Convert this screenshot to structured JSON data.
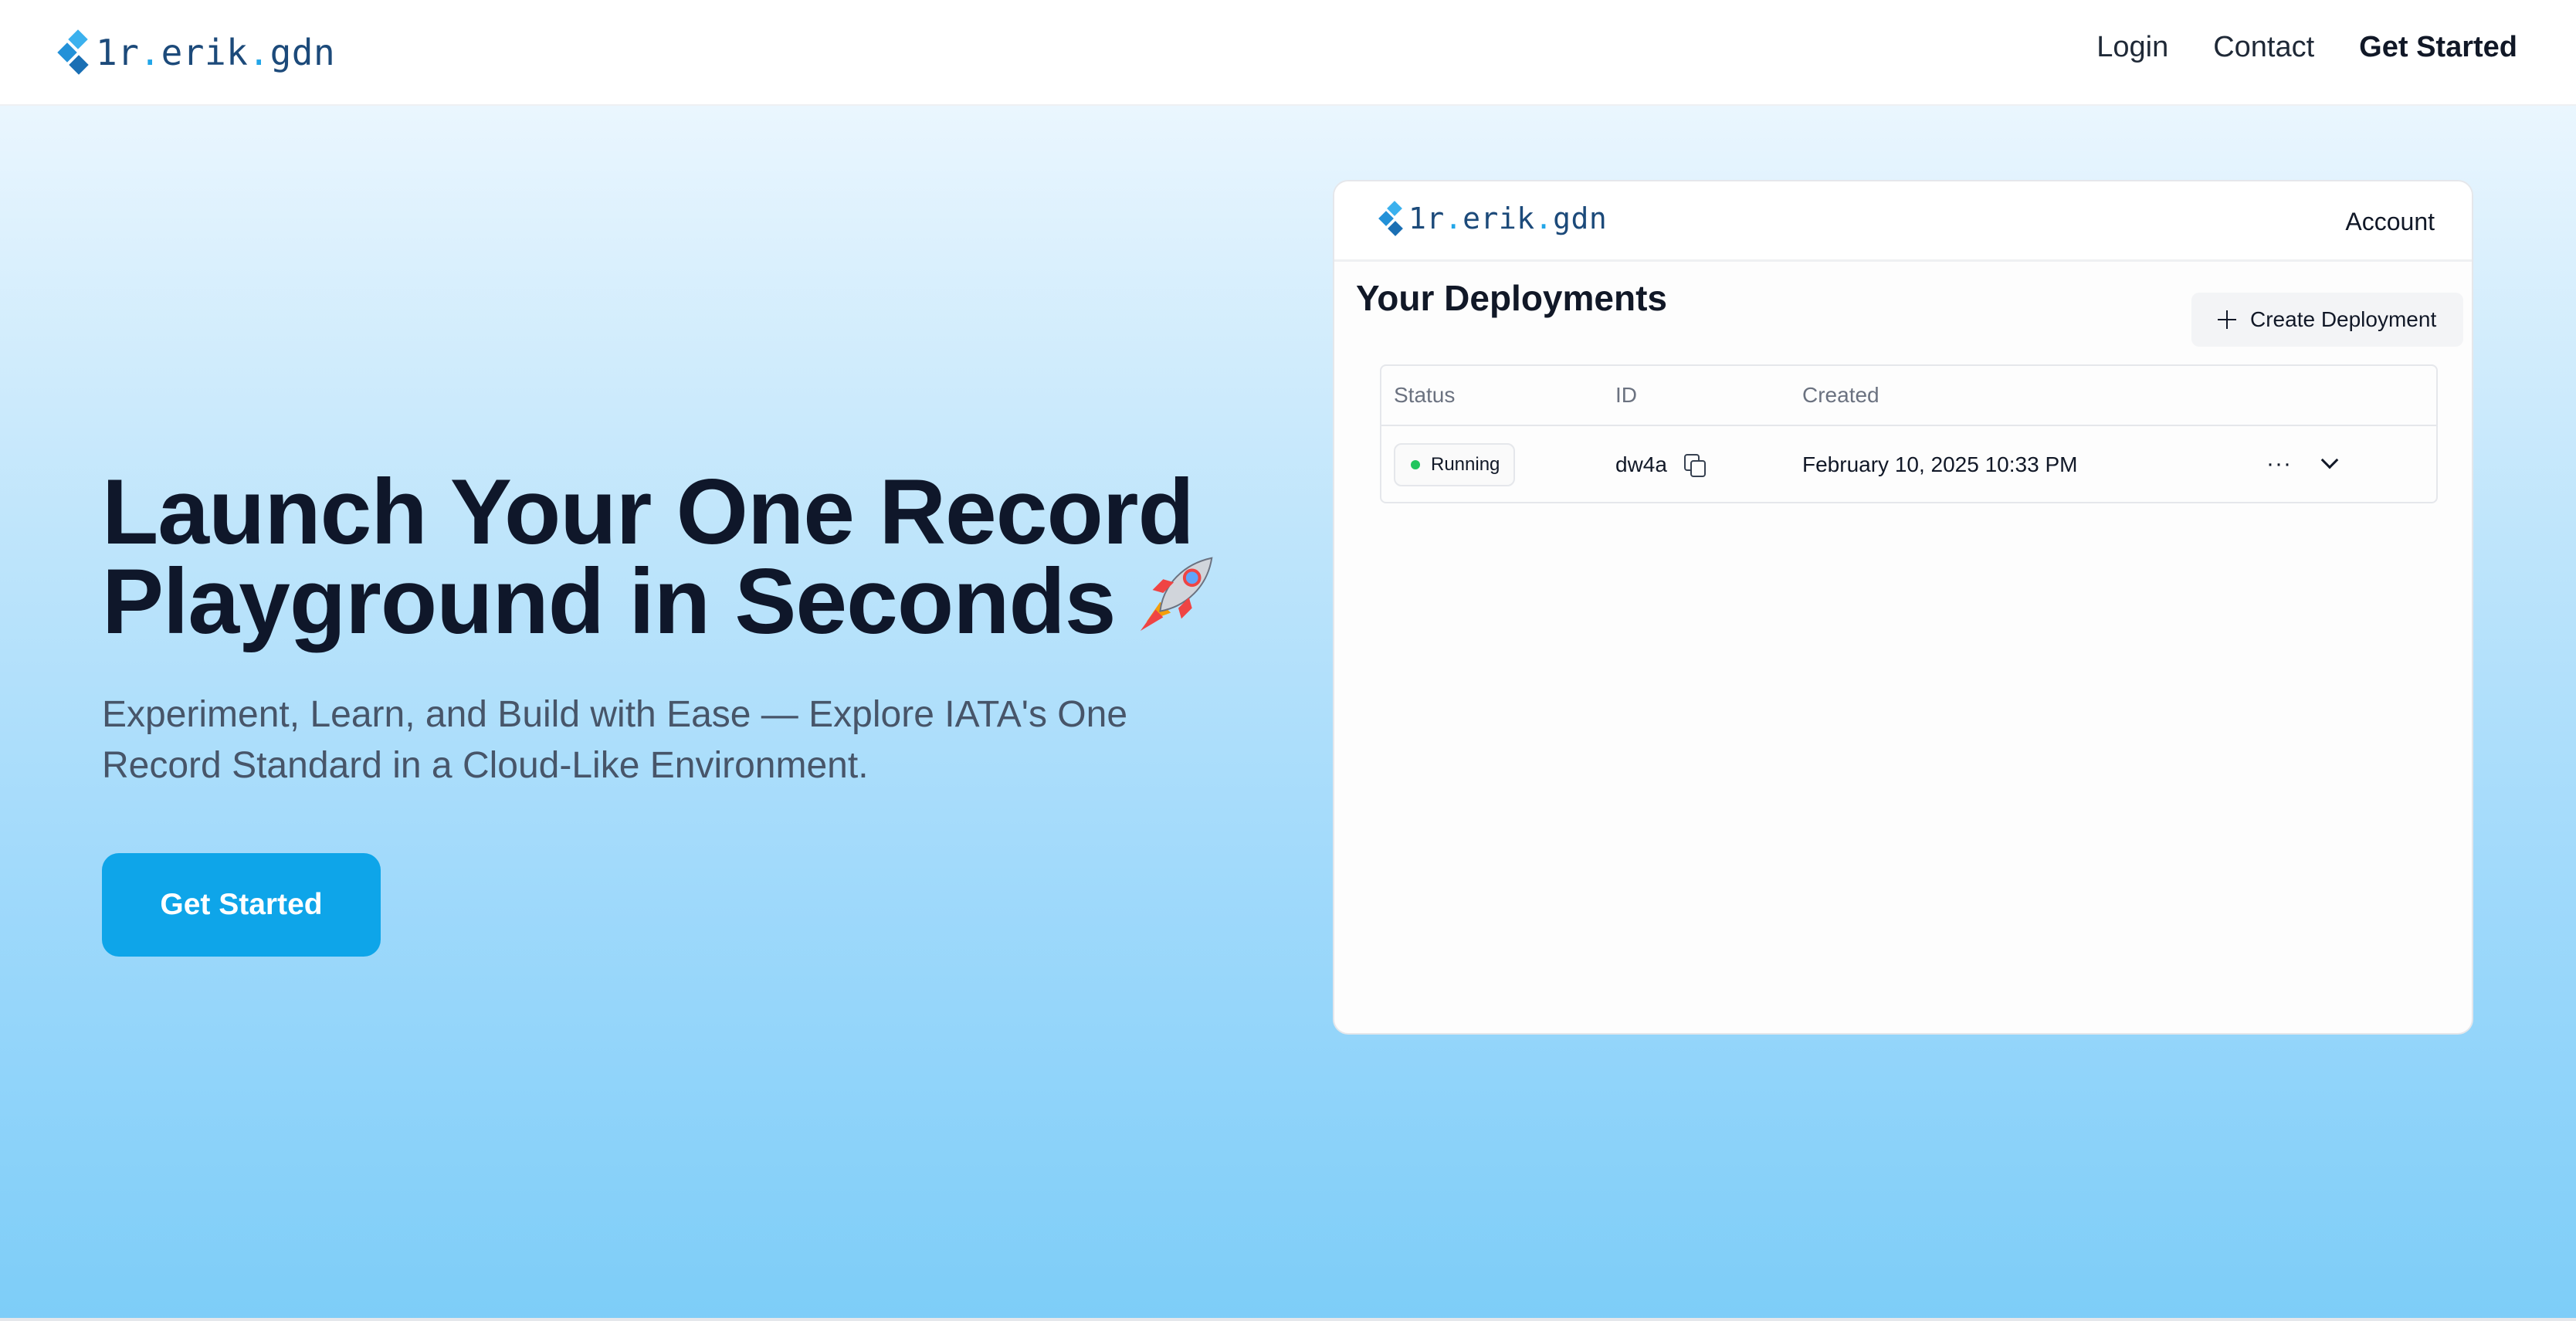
{
  "brand": {
    "logo_text_a": "1r",
    "logo_dot": ".",
    "logo_text_b": "erik",
    "logo_dot2": ".",
    "logo_text_c": "gdn"
  },
  "nav": {
    "login": "Login",
    "contact": "Contact",
    "get_started": "Get Started"
  },
  "hero": {
    "headline_line1": "Launch Your One Record",
    "headline_line2": "Playground in Seconds",
    "rocket_emoji": "🚀",
    "subtitle": "Experiment, Learn, and Build with Ease — Explore IATA's One Record Standard in a Cloud-Like Environment.",
    "cta_label": "Get Started"
  },
  "preview": {
    "account_label": "Account",
    "title": "Your Deployments",
    "create_button": "Create Deployment",
    "columns": [
      "Status",
      "ID",
      "Created"
    ],
    "rows": [
      {
        "status": "Running",
        "id": "dw4a",
        "created": "February 10, 2025 10:33 PM",
        "more": "···"
      }
    ]
  },
  "colors": {
    "accent": "#0ea5e9",
    "brand_navy": "#1c4a7a",
    "status_running": "#22c55e",
    "headline": "#0f172a"
  },
  "icons": [
    "logo-mark-icon",
    "plus-icon",
    "copy-icon",
    "more-icon",
    "chevron-down-icon",
    "rocket-icon"
  ]
}
